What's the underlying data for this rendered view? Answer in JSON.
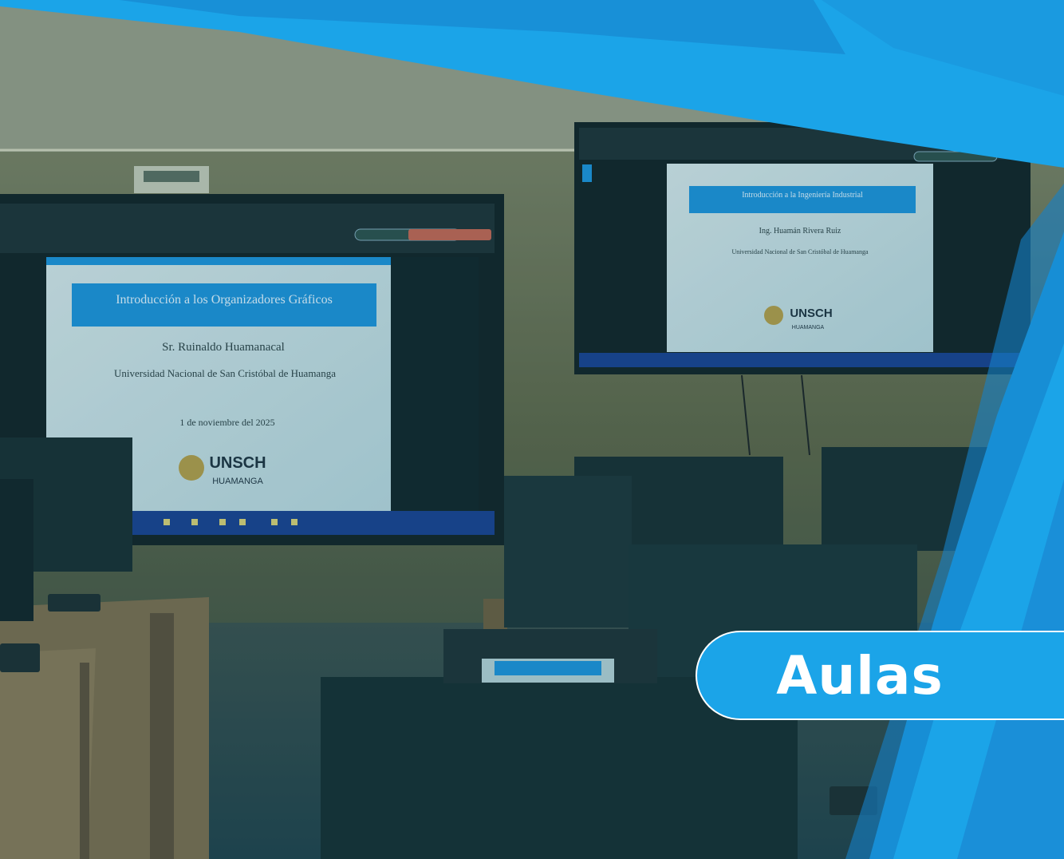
{
  "badge": {
    "label": "Aulas"
  },
  "left_screen": {
    "slide_title": "Introducción a los Organizadores Gráficos",
    "slide_author": "Sr. Ruinaldo Huamanacal",
    "slide_institution": "Universidad Nacional de San Cristóbal de Huamanga",
    "slide_date": "1 de noviembre del 2025",
    "logo_text": "UNSCH",
    "logo_sub": "HUAMANGA"
  },
  "right_screen": {
    "slide_title": "Introducción a la Ingeniería Industrial",
    "slide_author": "Ing. Huamán Rivera Ruiz",
    "slide_institution": "Universidad Nacional de San Cristóbal de Huamanga",
    "logo_text": "UNSCH",
    "logo_sub": "HUAMANGA"
  },
  "colors": {
    "accent": "#1ba4e8",
    "accent_dark": "#1580c8",
    "wall": "#5c5f3c",
    "slide_blue": "#1a8fd8"
  }
}
